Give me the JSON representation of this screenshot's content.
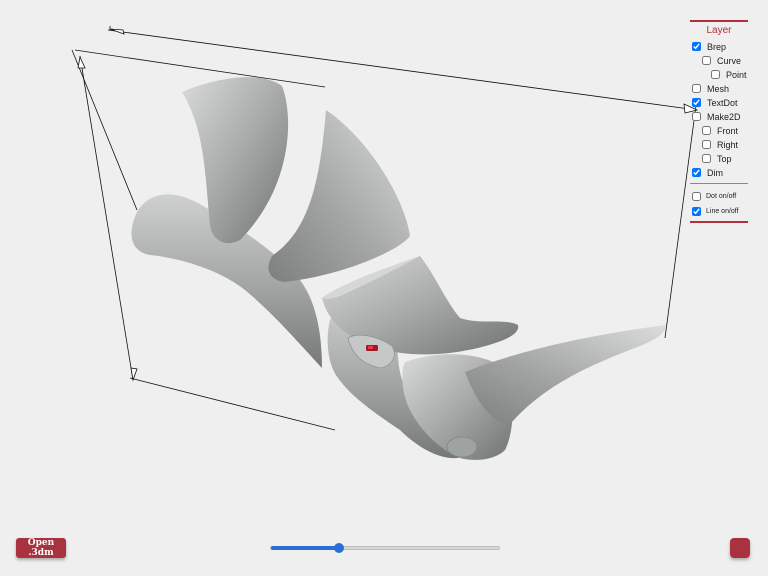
{
  "layer_panel": {
    "title": "Layer",
    "layers": [
      {
        "label": "Brep",
        "checked": true
      },
      {
        "label": "Curve",
        "checked": false
      },
      {
        "label": "Point",
        "checked": false
      },
      {
        "label": "Mesh",
        "checked": false
      },
      {
        "label": "TextDot",
        "checked": true
      },
      {
        "label": "Make2D",
        "checked": false
      },
      {
        "label": "Front",
        "checked": false
      },
      {
        "label": "Right",
        "checked": false
      },
      {
        "label": "Top",
        "checked": false
      },
      {
        "label": "Dim",
        "checked": true
      }
    ],
    "toggles": [
      {
        "label": "Dot on/off",
        "checked": false
      },
      {
        "label": "Line on/off",
        "checked": true
      }
    ]
  },
  "controls": {
    "open_label": "Open .3dm",
    "slider_value": 0.3
  },
  "colors": {
    "accent": "#b0303c",
    "button": "#a8323e",
    "slider": "#2a6fd6",
    "background": "#efefef",
    "model": "#a4a8a6"
  }
}
